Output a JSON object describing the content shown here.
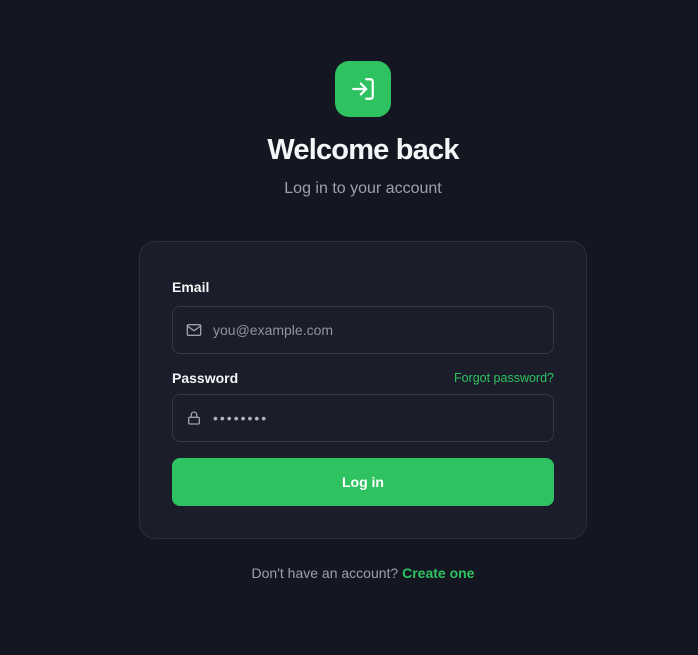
{
  "header": {
    "logo_icon": "login-arrow-icon",
    "title": "Welcome back",
    "subtitle": "Log in to your account"
  },
  "form": {
    "email": {
      "label": "Email",
      "placeholder": "you@example.com",
      "value": "",
      "icon": "mail-icon"
    },
    "password": {
      "label": "Password",
      "value": "••••••••",
      "icon": "lock-icon",
      "forgot_label": "Forgot password?"
    },
    "submit_label": "Log in"
  },
  "footer": {
    "prompt": "Don't have an account?",
    "link_label": "Create one"
  },
  "colors": {
    "background": "#141722",
    "card": "#1b1e2a",
    "accent": "#2ec360",
    "muted_text": "#9ca1ad"
  }
}
